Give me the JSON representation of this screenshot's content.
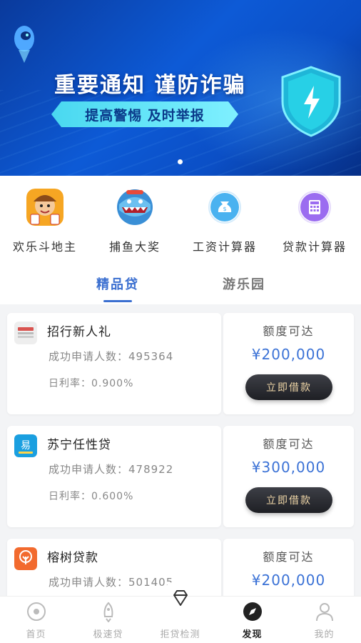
{
  "banner": {
    "title": "重要通知 谨防诈骗",
    "subtitle": "提高警惕  及时举报"
  },
  "quick_links": [
    {
      "label": "欢乐斗地主",
      "icon": "poker-game-icon"
    },
    {
      "label": "捕鱼大奖",
      "icon": "shark-game-icon"
    },
    {
      "label": "工资计算器",
      "icon": "money-bag-icon"
    },
    {
      "label": "贷款计算器",
      "icon": "calculator-icon"
    }
  ],
  "tabs": [
    {
      "label": "精品贷",
      "active": true
    },
    {
      "label": "游乐园",
      "active": false
    }
  ],
  "loans": [
    {
      "name": "招行新人礼",
      "applicants": "成功申请人数：495364",
      "rate": "日利率：0.900%",
      "limit_label": "额度可达",
      "amount": "¥200,000",
      "button": "立即借款"
    },
    {
      "name": "苏宁任性贷",
      "applicants": "成功申请人数：478922",
      "rate": "日利率：0.600%",
      "limit_label": "额度可达",
      "amount": "¥300,000",
      "button": "立即借款"
    },
    {
      "name": "榕树贷款",
      "applicants": "成功申请人数：501405",
      "rate": "",
      "limit_label": "额度可达",
      "amount": "¥200,000",
      "button": ""
    }
  ],
  "bottom_nav": [
    {
      "label": "首页",
      "icon": "home-icon",
      "active": false
    },
    {
      "label": "极速贷",
      "icon": "rocket-icon",
      "active": false
    },
    {
      "label": "拒贷检测",
      "icon": "diamond-icon",
      "active": false
    },
    {
      "label": "发现",
      "icon": "compass-icon",
      "active": true
    },
    {
      "label": "我的",
      "icon": "user-icon",
      "active": false
    }
  ],
  "colors": {
    "accent": "#3b6fd0",
    "amount": "#3b72d6",
    "button_bg": "#2b2c31",
    "button_text": "#f0d7a8"
  }
}
